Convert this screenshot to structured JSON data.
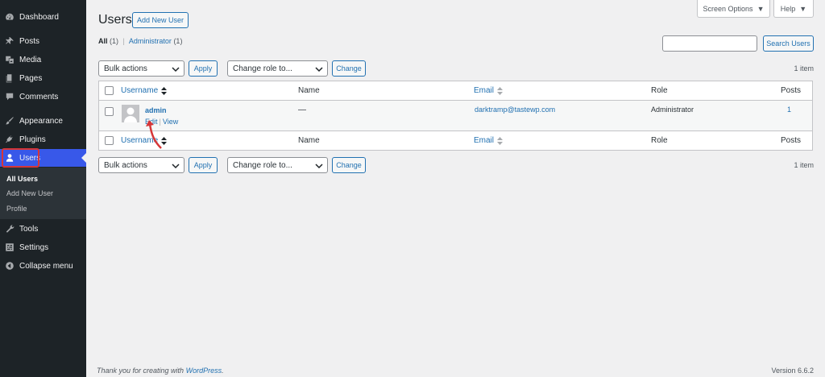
{
  "sidebar": {
    "items": [
      {
        "label": "Dashboard",
        "icon": "dashboard-icon"
      },
      {
        "label": "Posts",
        "icon": "pin-icon"
      },
      {
        "label": "Media",
        "icon": "media-icon"
      },
      {
        "label": "Pages",
        "icon": "pages-icon"
      },
      {
        "label": "Comments",
        "icon": "comment-icon"
      },
      {
        "label": "Appearance",
        "icon": "brush-icon"
      },
      {
        "label": "Plugins",
        "icon": "plug-icon"
      },
      {
        "label": "Users",
        "icon": "user-icon"
      },
      {
        "label": "Tools",
        "icon": "wrench-icon"
      },
      {
        "label": "Settings",
        "icon": "settings-icon"
      },
      {
        "label": "Collapse menu",
        "icon": "collapse-icon"
      }
    ],
    "submenu": [
      "All Users",
      "Add New User",
      "Profile"
    ]
  },
  "top": {
    "screen_options": "Screen Options",
    "help": "Help"
  },
  "header": {
    "title": "Users",
    "add_new": "Add New User"
  },
  "filters": {
    "all_label": "All",
    "all_count": "(1)",
    "sep": "|",
    "admin_label": "Administrator",
    "admin_count": "(1)"
  },
  "search": {
    "button": "Search Users",
    "value": ""
  },
  "bulk": {
    "bulk_actions": "Bulk actions",
    "apply": "Apply",
    "change_role": "Change role to...",
    "change": "Change",
    "count": "1 item"
  },
  "table": {
    "columns": [
      "Username",
      "Name",
      "Email",
      "Role",
      "Posts"
    ],
    "rows": [
      {
        "username": "admin",
        "name": "—",
        "email": "darktramp@tastewp.com",
        "role": "Administrator",
        "posts": "1",
        "actions": [
          "Edit",
          "View"
        ],
        "action_sep": "|"
      }
    ]
  },
  "footer": {
    "thanks_prefix": "Thank you for creating with",
    "wordpress": "WordPress",
    "thanks_suffix": ".",
    "version": "Version 6.6.2"
  },
  "colors": {
    "sidebar_bg": "#1d2327",
    "active_bg": "#3858e9",
    "link": "#2271b1",
    "highlight": "#d63638"
  }
}
